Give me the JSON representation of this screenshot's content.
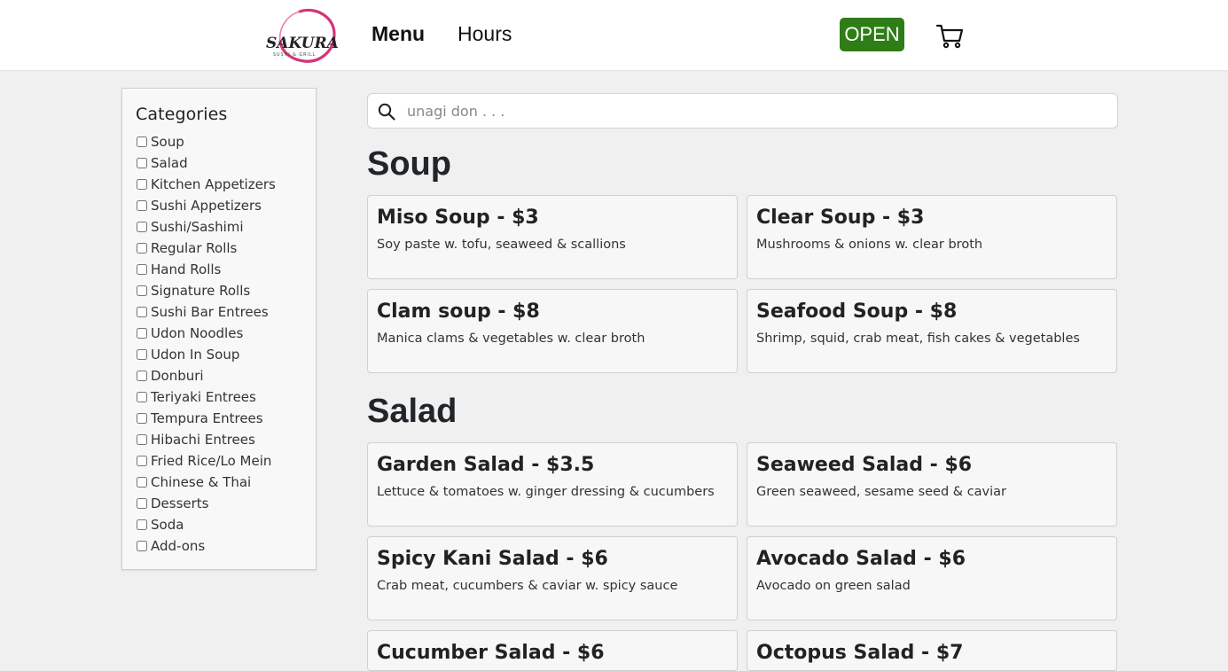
{
  "header": {
    "logo_text": "SAKURA",
    "logo_subtext": "SUSHI & GRILL",
    "nav_menu": "Menu",
    "nav_hours": "Hours",
    "status": "OPEN",
    "status_color": "#2e7d17"
  },
  "sidebar": {
    "title": "Categories",
    "items": [
      {
        "label": "Soup"
      },
      {
        "label": "Salad"
      },
      {
        "label": "Kitchen Appetizers"
      },
      {
        "label": "Sushi Appetizers"
      },
      {
        "label": "Sushi/Sashimi"
      },
      {
        "label": "Regular Rolls"
      },
      {
        "label": "Hand Rolls"
      },
      {
        "label": "Signature Rolls"
      },
      {
        "label": "Sushi Bar Entrees"
      },
      {
        "label": "Udon Noodles"
      },
      {
        "label": "Udon In Soup"
      },
      {
        "label": "Donburi"
      },
      {
        "label": "Teriyaki Entrees"
      },
      {
        "label": "Tempura Entrees"
      },
      {
        "label": "Hibachi Entrees"
      },
      {
        "label": "Fried Rice/Lo Mein"
      },
      {
        "label": "Chinese & Thai"
      },
      {
        "label": "Desserts"
      },
      {
        "label": "Soda"
      },
      {
        "label": "Add-ons"
      }
    ]
  },
  "search": {
    "placeholder": "unagi don . . ."
  },
  "menu": {
    "sections": [
      {
        "title": "Soup",
        "items": [
          {
            "name": "Miso Soup - $3",
            "desc": "Soy paste w. tofu, seaweed & scallions"
          },
          {
            "name": "Clear Soup - $3",
            "desc": "Mushrooms & onions w. clear broth"
          },
          {
            "name": "Clam soup - $8",
            "desc": "Manica clams & vegetables w. clear broth"
          },
          {
            "name": "Seafood Soup - $8",
            "desc": "Shrimp, squid, crab meat, fish cakes & vegetables"
          }
        ]
      },
      {
        "title": "Salad",
        "items": [
          {
            "name": "Garden Salad - $3.5",
            "desc": "Lettuce & tomatoes w. ginger dressing & cucumbers"
          },
          {
            "name": "Seaweed Salad - $6",
            "desc": "Green seaweed, sesame seed & caviar"
          },
          {
            "name": "Spicy Kani Salad - $6",
            "desc": "Crab meat, cucumbers & caviar w. spicy sauce"
          },
          {
            "name": "Avocado Salad - $6",
            "desc": "Avocado on green salad"
          },
          {
            "name": "Cucumber Salad - $6",
            "desc": ""
          },
          {
            "name": "Octopus Salad - $7",
            "desc": ""
          }
        ]
      }
    ]
  }
}
